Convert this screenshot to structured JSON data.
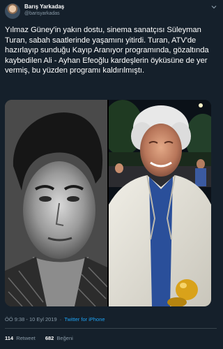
{
  "author": {
    "name": "Barış Yarkadaş",
    "handle": "@barisyarkadas"
  },
  "tweet": {
    "text": "Yılmaz Güney'in yakın dostu, sinema sanatçısı Süleyman Turan, sabah saatlerinde yaşamını yitirdi. Turan, ATV'de hazırlayıp sunduğu Kayıp Aranıyor programında, gözaltında kaybedilen Ali - Ayhan Efeoğlu kardeşlerin öyküsüne de yer vermiş, bu yüzden programı kaldırılmıştı.",
    "timestamp": "ÖÖ 9:38 - 10 Eyl 2019",
    "separator": "·",
    "client": "Twitter for iPhone"
  },
  "stats": {
    "retweets_count": "114",
    "retweets_label": "Retweet",
    "likes_count": "682",
    "likes_label": "Beğeni"
  },
  "icons": {
    "more": "chevron-down-icon",
    "reply": "reply-icon",
    "retweet": "retweet-icon",
    "like": "heart-icon",
    "share": "share-icon"
  },
  "colors": {
    "background": "#15202b",
    "text": "#ffffff",
    "secondary": "#8899a6",
    "link": "#1da1f2",
    "divider": "#38444d"
  }
}
